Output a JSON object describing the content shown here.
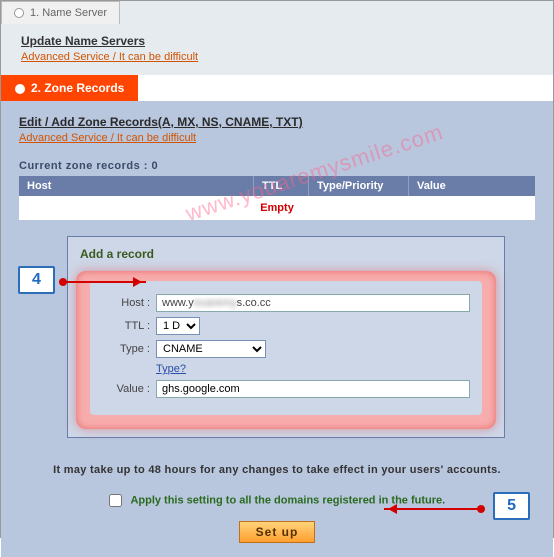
{
  "section1": {
    "tab": "1. Name Server",
    "title": "Update Name Servers",
    "sub": "Advanced Service / It can be difficult"
  },
  "section2": {
    "tab": "2. Zone Records",
    "title": "Edit / Add Zone Records(A, MX, NS, CNAME, TXT)",
    "sub": "Advanced Service / It can be difficult",
    "current_label": "Current zone records : 0",
    "headers": {
      "host": "Host",
      "ttl": "TTL",
      "type": "Type/Priority",
      "value": "Value"
    },
    "empty": "Empty",
    "add_title": "Add a record",
    "form": {
      "host_label": "Host :",
      "host_prefix": "www.y",
      "host_blurred": "ouaremy",
      "host_suffix": "s.co.cc",
      "ttl_label": "TTL :",
      "ttl_value": "1 D",
      "type_label": "Type :",
      "type_value": "CNAME",
      "type_link": "Type?",
      "value_label": "Value :",
      "value_value": "ghs.google.com"
    },
    "note": "It may take up to 48 hours for any changes to take effect in your users' accounts.",
    "apply": "Apply this setting to all the domains registered in the future.",
    "setup": "Set up"
  },
  "callouts": {
    "c4": "4",
    "c5": "5"
  },
  "watermark": "www.youaremysmile.com"
}
